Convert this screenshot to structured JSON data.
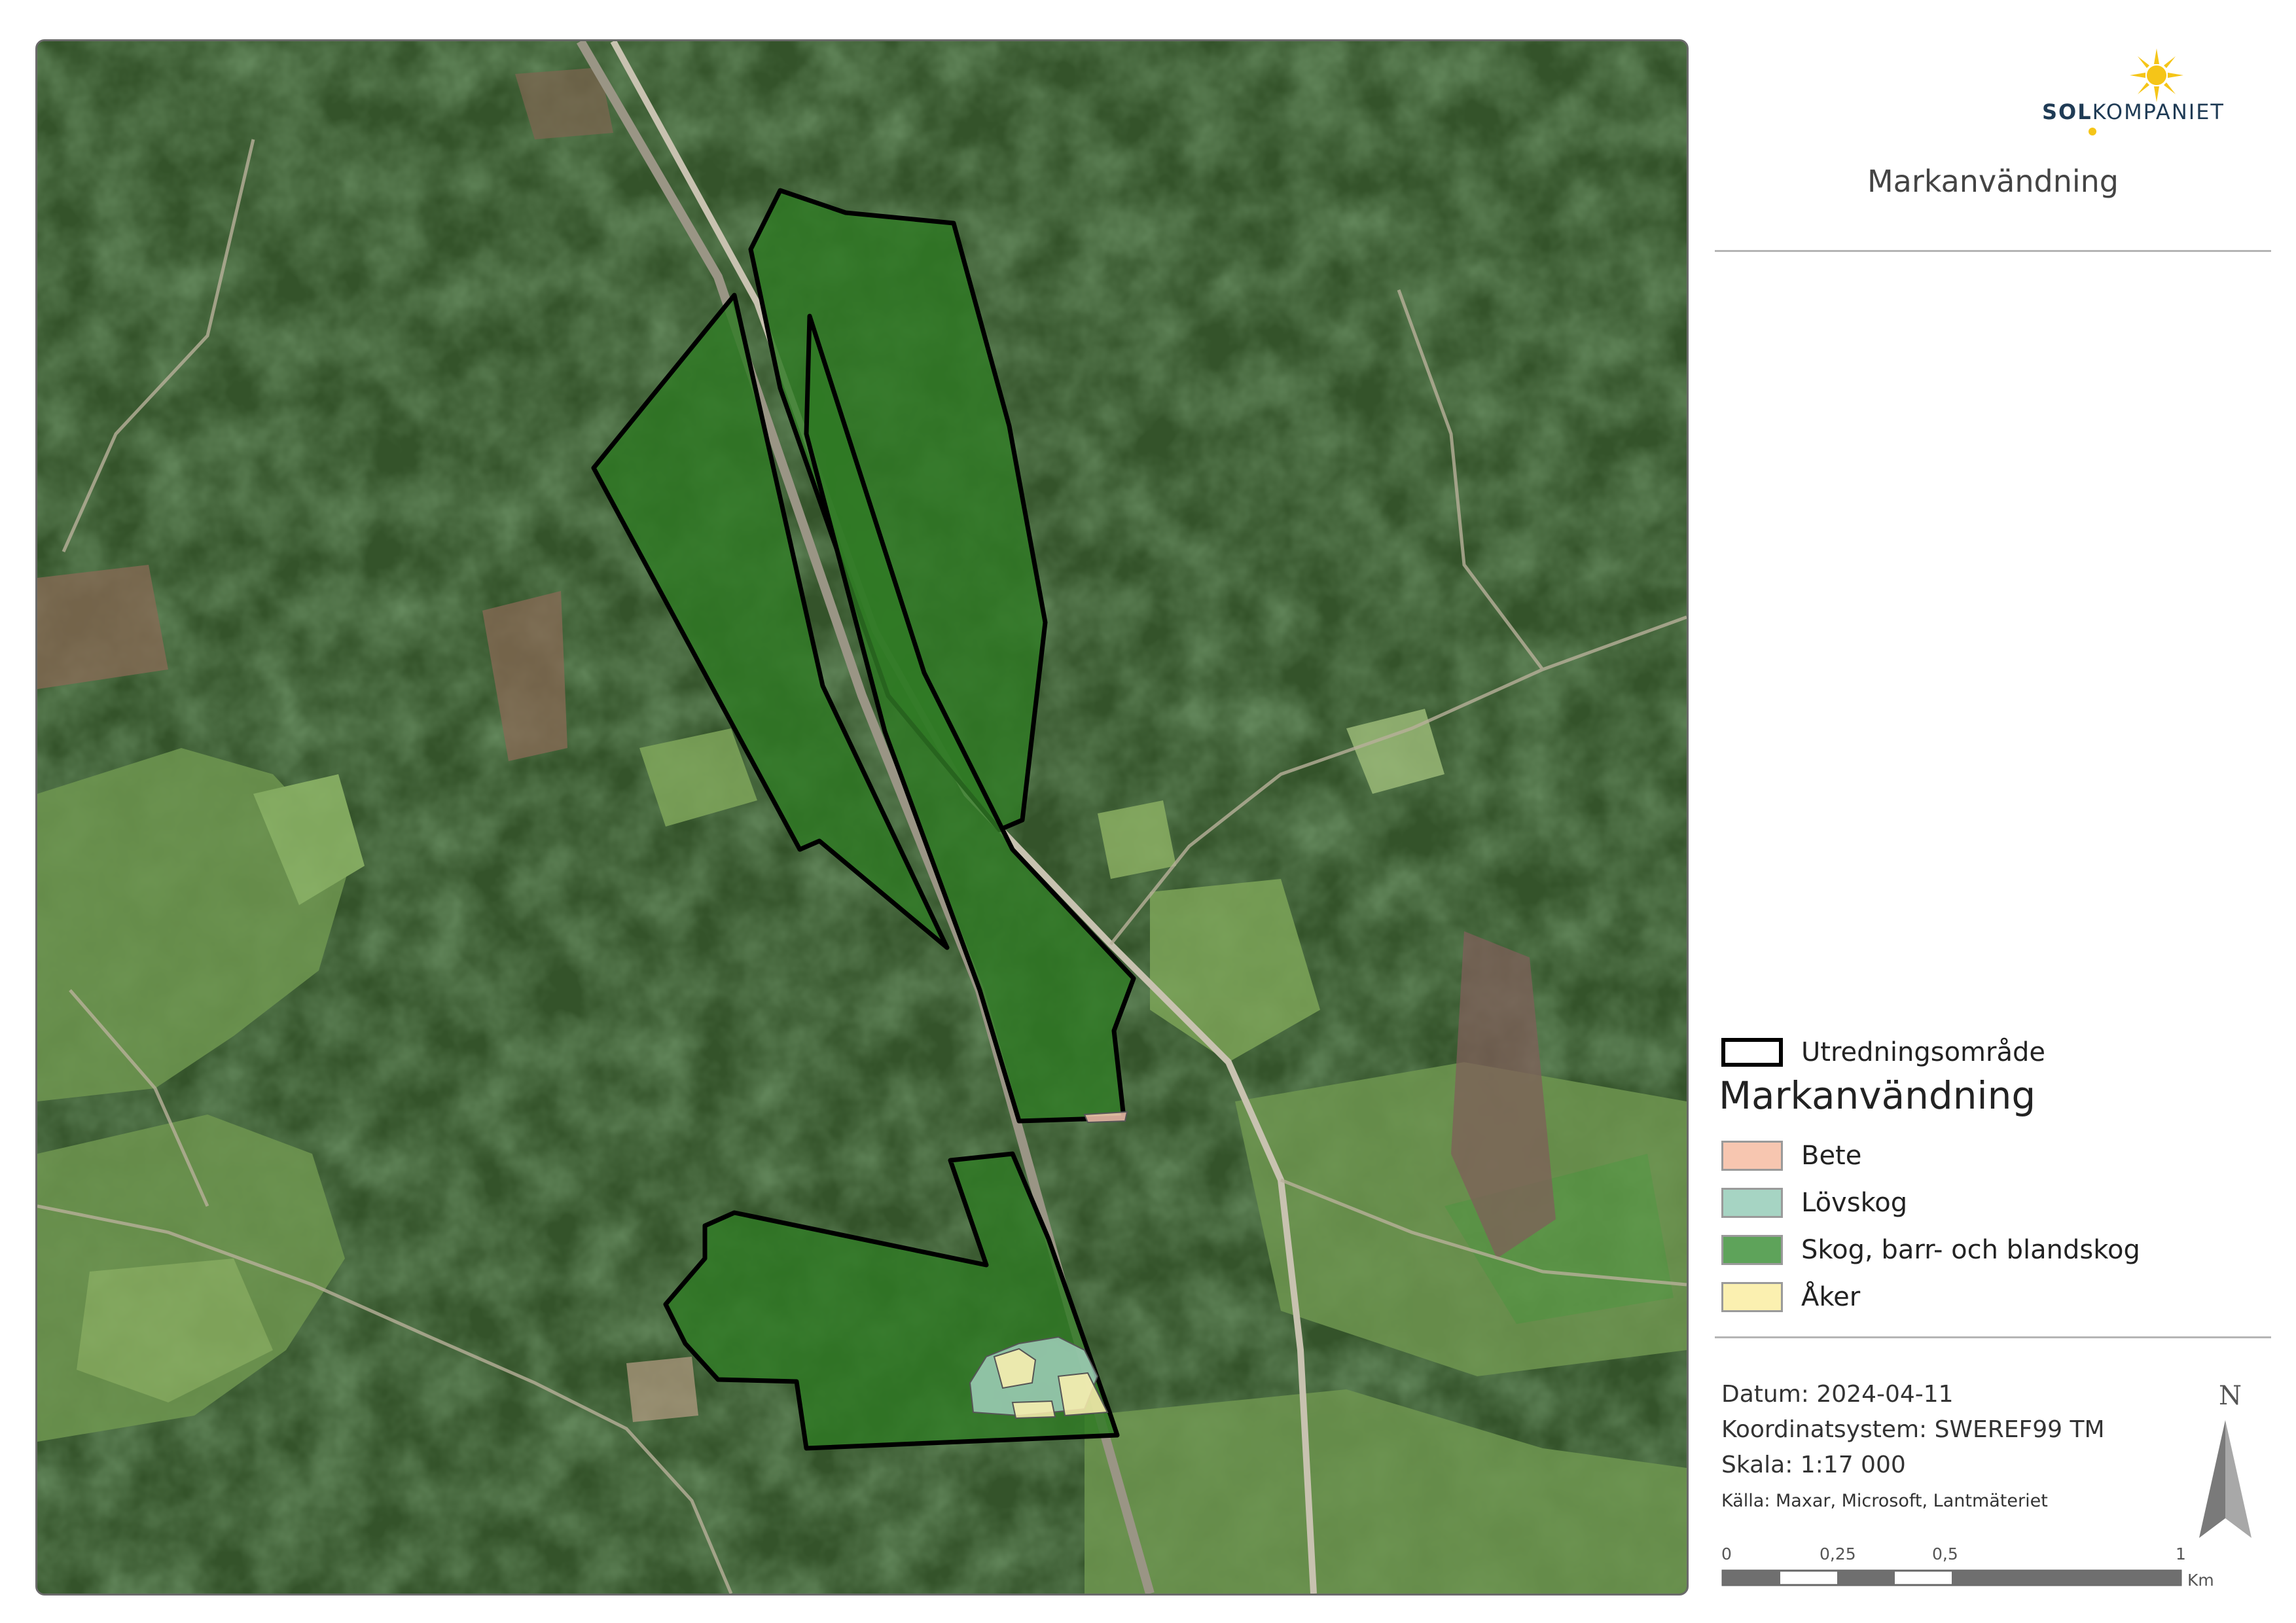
{
  "map": {
    "source_credit": "Källa: Maxar, Microsoft, Lantmäteriet"
  },
  "brand": {
    "logo_text_bold": "SOL",
    "logo_text_rest": "KOMPANIET",
    "sun_color": "#f5c518",
    "text_color": "#1f3b55"
  },
  "panel": {
    "title": "Markanvändning"
  },
  "legend": {
    "boundary_label": "Utredningsområde",
    "heading": "Markanvändning",
    "classes": [
      {
        "label": "Bete",
        "color": "#f7c6b0"
      },
      {
        "label": "Lövskog",
        "color": "#a6d4c3"
      },
      {
        "label": "Skog, barr- och blandskog",
        "color": "#5ea35a"
      },
      {
        "label": "Åker",
        "color": "#fbf0b0"
      }
    ]
  },
  "info": {
    "date": "Datum: 2024-04-11",
    "crs": "Koordinatsystem: SWEREF99 TM",
    "scale": "Skala: 1:17 000",
    "source": "Källa: Maxar, Microsoft, Lantmäteriet"
  },
  "north": {
    "letter": "N"
  },
  "scalebar": {
    "ticks": [
      "0",
      "0,25",
      "0,5",
      "1"
    ],
    "unit": "Km"
  },
  "colors": {
    "study_area_fill": "#2f7a24",
    "study_area_stroke": "#000000",
    "forest_dark": "#2b4722",
    "forest_mid": "#3c5e2e",
    "field_light": "#7fa65a",
    "road": "#b9b4a5"
  }
}
